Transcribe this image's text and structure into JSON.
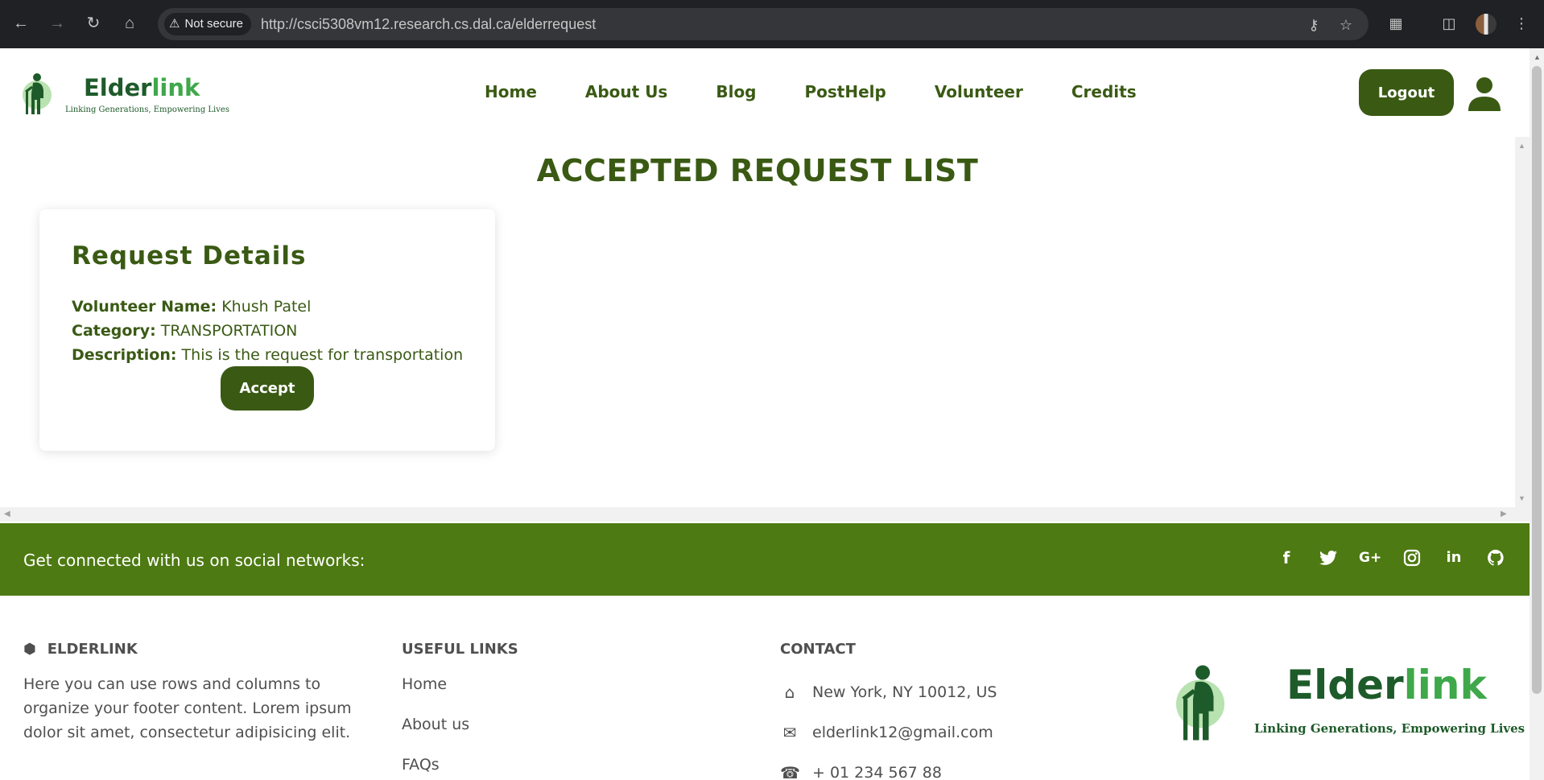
{
  "browser": {
    "security_label": "Not secure",
    "url": "http://csci5308vm12.research.cs.dal.ca/elderrequest"
  },
  "header": {
    "logo_name_dark": "Elder",
    "logo_name_light": "link",
    "logo_tagline": "Linking Generations, Empowering Lives",
    "nav": [
      "Home",
      "About Us",
      "Blog",
      "PostHelp",
      "Volunteer",
      "Credits"
    ],
    "logout_label": "Logout"
  },
  "main": {
    "title": "ACCEPTED REQUEST LIST",
    "card": {
      "heading": "Request Details",
      "volunteer_label": "Volunteer Name:",
      "volunteer_value": "Khush Patel",
      "category_label": "Category:",
      "category_value": "TRANSPORTATION",
      "description_label": "Description:",
      "description_value": "This is the request for transportation",
      "accept_label": "Accept"
    }
  },
  "social": {
    "text": "Get connected with us on social networks:",
    "icons": [
      "facebook-icon",
      "twitter-icon",
      "google-plus-icon",
      "instagram-icon",
      "linkedin-icon",
      "github-icon"
    ]
  },
  "footer": {
    "brand_heading": "ELDERLINK",
    "brand_text": "Here you can use rows and columns to organize your footer content. Lorem ipsum dolor sit amet, consectetur adipisicing elit.",
    "links_heading": "USEFUL LINKS",
    "links": [
      "Home",
      "About us",
      "FAQs"
    ],
    "contact_heading": "CONTACT",
    "contact_address": "New York, NY 10012, US",
    "contact_email": "elderlink12@gmail.com",
    "contact_phone": "+ 01 234 567 88"
  },
  "colors": {
    "brand_dark": "#3a5a14",
    "social_band": "#4d7a12",
    "logo_green": "#1e5b2a",
    "logo_light": "#3ea84a"
  }
}
